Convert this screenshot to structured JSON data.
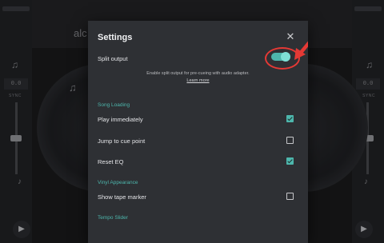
{
  "background": {
    "logo_text": "alc",
    "left_bpm": "0.0",
    "right_bpm": "0.0",
    "left_sync": "SYNC",
    "right_sync": "SYNC"
  },
  "dialog": {
    "title": "Settings",
    "split_output": {
      "label": "Split output",
      "enabled": true,
      "description": "Enable split output for pre-cueing with audio adapter.",
      "learn_more": "Learn more"
    },
    "sections": [
      {
        "title": "Song Loading",
        "items": [
          {
            "label": "Play immediately",
            "checked": true
          },
          {
            "label": "Jump to cue point",
            "checked": false
          },
          {
            "label": "Reset EQ",
            "checked": true
          }
        ]
      },
      {
        "title": "Vinyl Appearance",
        "items": [
          {
            "label": "Show tape marker",
            "checked": false
          }
        ]
      },
      {
        "title": "Tempo Slider",
        "items": []
      }
    ]
  },
  "colors": {
    "accent": "#4db6ac",
    "highlight": "#e53935",
    "dialog_bg": "#2e3034"
  },
  "icons": {
    "close": "close-icon",
    "pointer": "red-arrow-annotation"
  }
}
